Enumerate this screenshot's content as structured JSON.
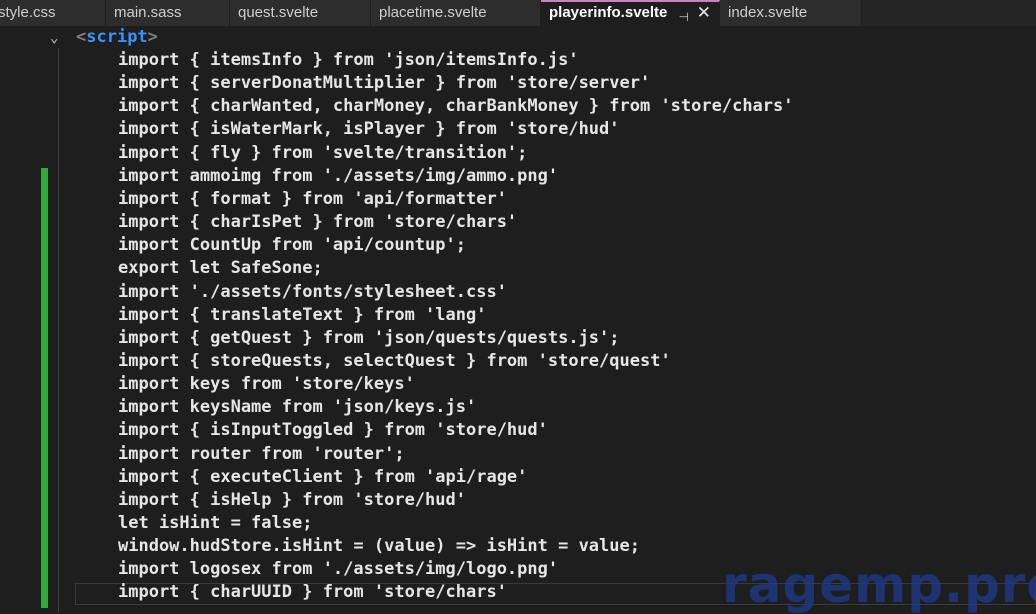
{
  "tabs": [
    {
      "label": "style.css"
    },
    {
      "label": "main.sass"
    },
    {
      "label": "quest.svelte"
    },
    {
      "label": "placetime.svelte"
    },
    {
      "label": "playerinfo.svelte",
      "active": true,
      "pin": "⊣",
      "close": "✕"
    },
    {
      "label": "index.svelte"
    }
  ],
  "editor": {
    "fold_marker": "⌄",
    "script_open": "<",
    "script_tag": "script",
    "script_close": ">",
    "lines": [
      "import { itemsInfo } from 'json/itemsInfo.js'",
      "import { serverDonatMultiplier } from 'store/server'",
      "import { charWanted, charMoney, charBankMoney } from 'store/chars'",
      "import { isWaterMark, isPlayer } from 'store/hud'",
      "import { fly } from 'svelte/transition';",
      "import ammoimg from './assets/img/ammo.png'",
      "import { format } from 'api/formatter'",
      "import { charIsPet } from 'store/chars'",
      "import CountUp from 'api/countup';",
      "export let SafeSone;",
      "import './assets/fonts/stylesheet.css'",
      "import { translateText } from 'lang'",
      "import { getQuest } from 'json/quests/quests.js';",
      "import { storeQuests, selectQuest } from 'store/quest'",
      "import keys from 'store/keys'",
      "import keysName from 'json/keys.js'",
      "import { isInputToggled } from 'store/hud'",
      "import router from 'router';",
      "import { executeClient } from 'api/rage'",
      "import { isHelp } from 'store/hud'",
      "let isHint = false;",
      "window.hudStore.isHint = (value) => isHint = value;",
      "import logosex from './assets/img/logo.png'",
      "import { charUUID } from 'store/chars'"
    ]
  },
  "watermark": "ragemp.pro",
  "colors": {
    "editor_bg": "#1e1e1e",
    "tab_bg": "#2d2d2d",
    "active_tab_accent": "#c586c0",
    "git_modified": "#36a83e",
    "tag_blue": "#3794ff",
    "watermark": "#1e3a8a"
  }
}
